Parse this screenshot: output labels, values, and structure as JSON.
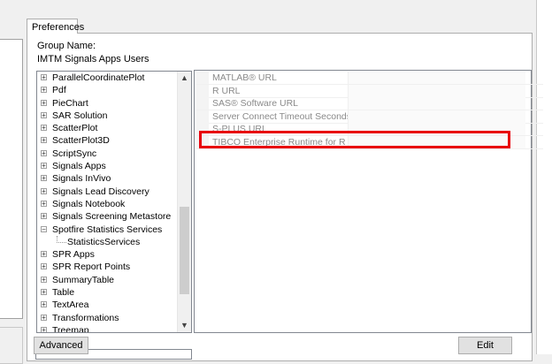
{
  "tab": {
    "label": "Preferences"
  },
  "group": {
    "label": "Group Name:",
    "value": "IMTM Signals Apps Users"
  },
  "tree": {
    "items": [
      {
        "label": "ParallelCoordinatePlot",
        "expander": "+"
      },
      {
        "label": "Pdf",
        "expander": "+"
      },
      {
        "label": "PieChart",
        "expander": "+"
      },
      {
        "label": "SAR Solution",
        "expander": "+"
      },
      {
        "label": "ScatterPlot",
        "expander": "+"
      },
      {
        "label": "ScatterPlot3D",
        "expander": "+"
      },
      {
        "label": "ScriptSync",
        "expander": "+"
      },
      {
        "label": "Signals Apps",
        "expander": "+"
      },
      {
        "label": "Signals InVivo",
        "expander": "+"
      },
      {
        "label": "Signals Lead Discovery",
        "expander": "+"
      },
      {
        "label": "Signals Notebook",
        "expander": "+"
      },
      {
        "label": "Signals Screening Metastore",
        "expander": "+"
      },
      {
        "label": "Spotfire Statistics Services",
        "expander": "−"
      },
      {
        "label": "StatisticsServices",
        "expander": ""
      },
      {
        "label": "SPR Apps",
        "expander": "+"
      },
      {
        "label": "SPR Report Points",
        "expander": "+"
      },
      {
        "label": "SummaryTable",
        "expander": "+"
      },
      {
        "label": "Table",
        "expander": "+"
      },
      {
        "label": "TextArea",
        "expander": "+"
      },
      {
        "label": "Transformations",
        "expander": "+"
      },
      {
        "label": "Treemap",
        "expander": "+"
      }
    ],
    "scroll_up_icon": "▲",
    "scroll_down_icon": "▼"
  },
  "properties": [
    {
      "name": "MATLAB® URL"
    },
    {
      "name": "R URL"
    },
    {
      "name": "SAS® Software URL"
    },
    {
      "name": "Server Connect Timeout Seconds"
    },
    {
      "name": "S-PLUS URL"
    },
    {
      "name": "TIBCO Enterprise Runtime for R URL"
    }
  ],
  "buttons": {
    "advanced": "Advanced",
    "edit": "Edit"
  },
  "colors": {
    "highlight": "#e8000b"
  }
}
